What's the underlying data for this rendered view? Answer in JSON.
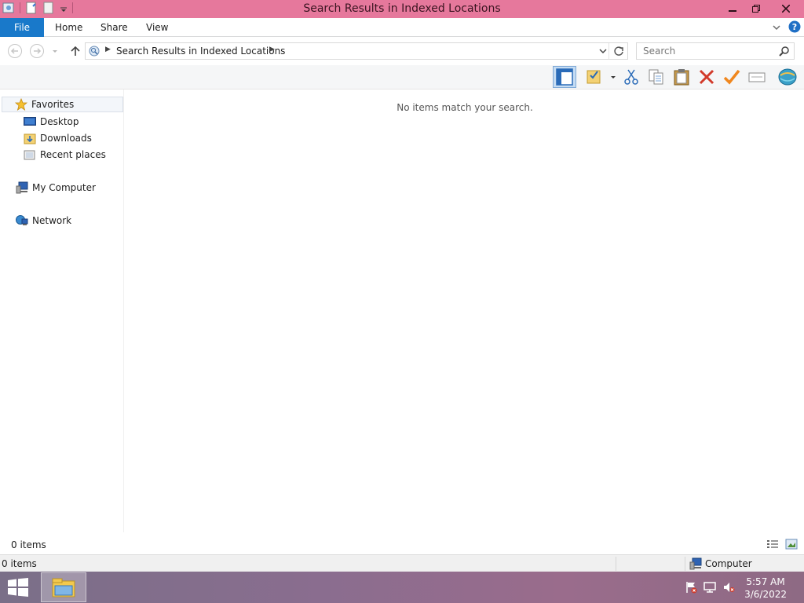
{
  "window": {
    "title": "Search Results in Indexed Locations",
    "accent_color": "#e6789c"
  },
  "ribbon": {
    "tabs": [
      {
        "label": "File"
      },
      {
        "label": "Home"
      },
      {
        "label": "Share"
      },
      {
        "label": "View"
      }
    ]
  },
  "address": {
    "path": "Search Results in Indexed Locations",
    "search_placeholder": "Search"
  },
  "toolbar": {
    "icons": [
      "preview-pane-icon",
      "select-folder-icon",
      "cut-icon",
      "copy-icon",
      "paste-icon",
      "delete-icon",
      "apply-icon",
      "rename-icon",
      "globe-icon"
    ]
  },
  "navpane": {
    "favorites_label": "Favorites",
    "favorites": [
      {
        "label": "Desktop"
      },
      {
        "label": "Downloads"
      },
      {
        "label": "Recent places"
      }
    ],
    "computer_label": "My Computer",
    "network_label": "Network"
  },
  "content": {
    "empty_message": "No items match your search."
  },
  "status": {
    "item_count": "0 items",
    "bottom_count": "0 items",
    "location": "Computer"
  },
  "taskbar": {
    "time": "5:57 AM",
    "date": "3/6/2022"
  }
}
